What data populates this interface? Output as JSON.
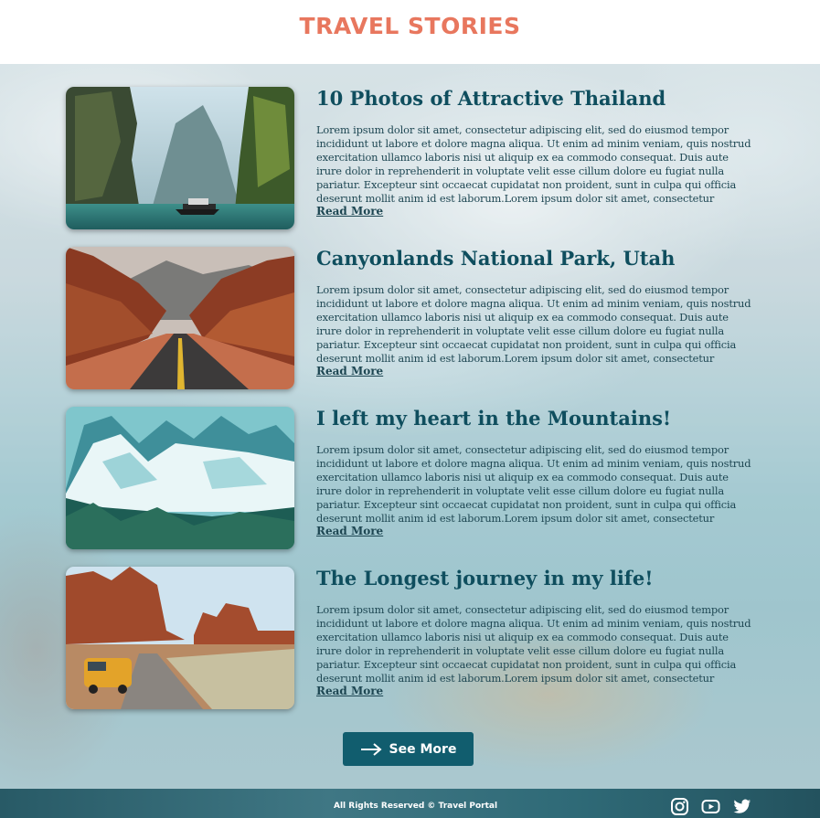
{
  "header": {
    "title": "TRAVEL STORIES"
  },
  "posts": [
    {
      "title": "10 Photos of Attractive Thailand",
      "body": "Lorem ipsum dolor sit amet, consectetur adipiscing elit, sed do eiusmod tempor incididunt ut labore et dolore magna aliqua. Ut enim ad minim veniam, quis nostrud exercitation ullamco laboris nisi ut aliquip ex ea commodo consequat. Duis aute irure dolor in reprehenderit in voluptate velit esse cillum dolore eu fugiat nulla pariatur. Excepteur sint occaecat cupidatat non proident, sunt in culpa qui officia deserunt mollit anim id est laborum.Lorem ipsum dolor sit amet, consectetur adipiscing elit...",
      "read_more": "Read More",
      "image": "thailand-cliffs-boat"
    },
    {
      "title": "Canyonlands National Park, Utah",
      "body": "Lorem ipsum dolor sit amet, consectetur adipiscing elit, sed do eiusmod tempor incididunt ut labore et dolore magna aliqua. Ut enim ad minim veniam, quis nostrud exercitation ullamco laboris nisi ut aliquip ex ea commodo consequat. Duis aute irure dolor in reprehenderit in voluptate velit esse cillum dolore eu fugiat nulla pariatur. Excepteur sint occaecat cupidatat non proident, sunt in culpa qui officia deserunt mollit anim id est laborum.Lorem ipsum dolor sit amet, consectetur adipiscing elit...",
      "read_more": "Read More",
      "image": "canyon-road"
    },
    {
      "title": "I left my heart in the Mountains!",
      "body": "Lorem ipsum dolor sit amet, consectetur adipiscing elit, sed do eiusmod tempor incididunt ut labore et dolore magna aliqua. Ut enim ad minim veniam, quis nostrud exercitation ullamco laboris nisi ut aliquip ex ea commodo consequat. Duis aute irure dolor in reprehenderit in voluptate velit esse cillum dolore eu fugiat nulla pariatur. Excepteur sint occaecat cupidatat non proident, sunt in culpa qui officia deserunt mollit anim id est laborum.Lorem ipsum dolor sit amet, consectetur adipiscing elit...",
      "read_more": "Read More",
      "image": "snowy-mountains"
    },
    {
      "title": "The Longest journey in my life!",
      "body": "Lorem ipsum dolor sit amet, consectetur adipiscing elit, sed do eiusmod tempor incididunt ut labore et dolore magna aliqua. Ut enim ad minim veniam, quis nostrud exercitation ullamco laboris nisi ut aliquip ex ea commodo consequat. Duis aute irure dolor in reprehenderit in voluptate velit esse cillum dolore eu fugiat nulla pariatur. Excepteur sint occaecat cupidatat non proident, sunt in culpa qui officia deserunt mollit anim id est laborum.Lorem ipsum dolor sit amet, consectetur adipiscing elit...",
      "read_more": "Read More",
      "image": "desert-van"
    }
  ],
  "see_more": {
    "label": "See More",
    "icon": "arrow-right-icon"
  },
  "footer": {
    "copyright": "All Rights Reserved © Travel Portal",
    "social": [
      "instagram-icon",
      "youtube-icon",
      "twitter-icon"
    ]
  },
  "colors": {
    "title_accent": "#e8775e",
    "heading": "#0f4e5e",
    "button": "#115d6e",
    "footer": "#2f6a77"
  }
}
